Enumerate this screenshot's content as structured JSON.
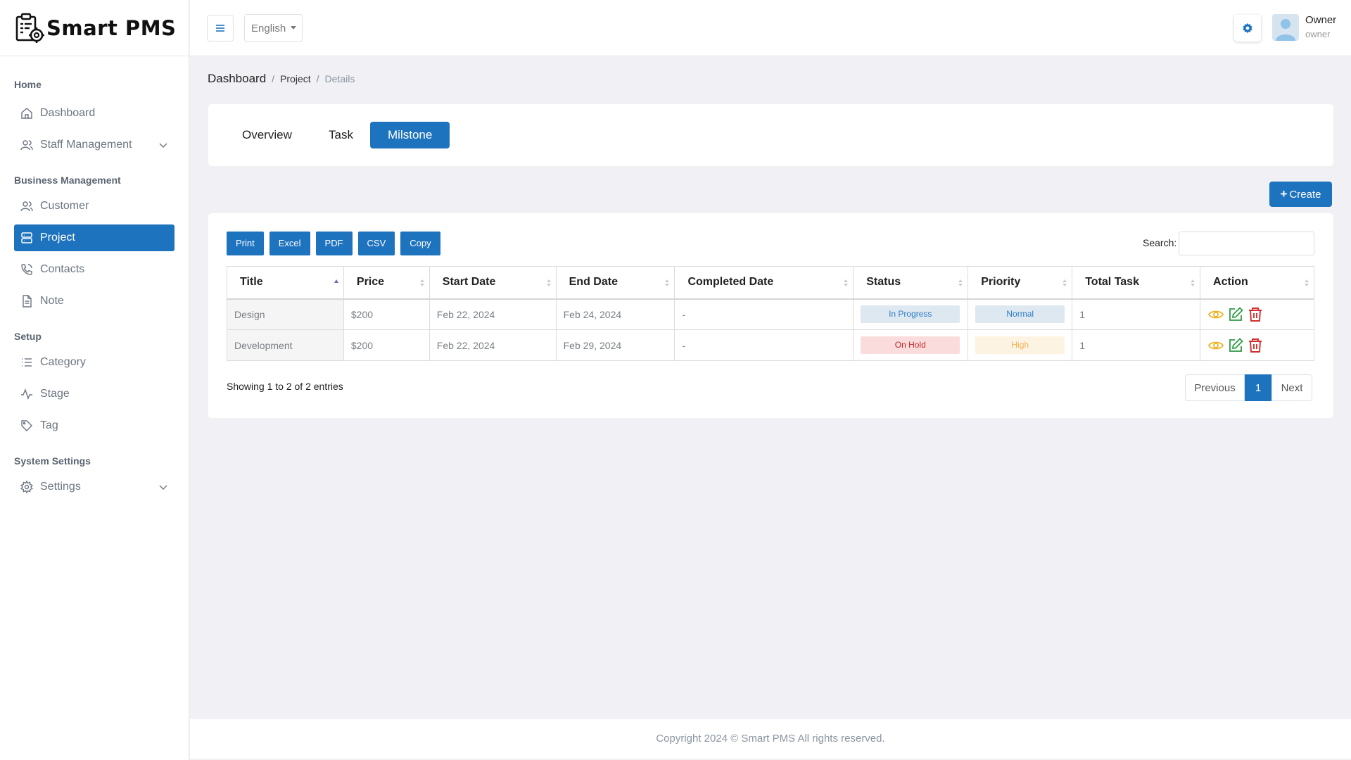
{
  "brand": {
    "name": "Smart PMS",
    "logo_icon": "clipboard-gear-icon"
  },
  "sidebar": {
    "sections": [
      {
        "label": "Home"
      },
      {
        "label": "Business Management"
      },
      {
        "label": "Setup"
      },
      {
        "label": "System Settings"
      }
    ],
    "items": {
      "dashboard": "Dashboard",
      "staff": "Staff Management",
      "customer": "Customer",
      "project": "Project",
      "contacts": "Contacts",
      "note": "Note",
      "category": "Category",
      "stage": "Stage",
      "tag": "Tag",
      "settings": "Settings"
    },
    "active_item": "Project"
  },
  "topbar": {
    "language": "English",
    "user": {
      "name": "Owner",
      "role": "owner"
    }
  },
  "breadcrumb": {
    "home": "Dashboard",
    "parent": "Project",
    "current": "Details",
    "separator": "/"
  },
  "tabs": [
    {
      "label": "Overview",
      "active": false
    },
    {
      "label": "Task",
      "active": false
    },
    {
      "label": "Milstone",
      "active": true
    }
  ],
  "create_button": {
    "label": "Create"
  },
  "export_buttons": [
    "Print",
    "Excel",
    "PDF",
    "CSV",
    "Copy"
  ],
  "search": {
    "label": "Search:",
    "value": ""
  },
  "table": {
    "columns": [
      "Title",
      "Price",
      "Start Date",
      "End Date",
      "Completed Date",
      "Status",
      "Priority",
      "Total Task",
      "Action"
    ],
    "sorted_column": "Title",
    "rows": [
      {
        "title": "Design",
        "price": "$200",
        "start": "Feb 22, 2024",
        "end": "Feb 24, 2024",
        "completed": "-",
        "status": "In Progress",
        "priority": "Normal",
        "total": "1"
      },
      {
        "title": "Development",
        "price": "$200",
        "start": "Feb 22, 2024",
        "end": "Feb 29, 2024",
        "completed": "-",
        "status": "On Hold",
        "priority": "High",
        "total": "1"
      }
    ]
  },
  "pagination": {
    "info": "Showing 1 to 2 of 2 entries",
    "previous": "Previous",
    "current_page": "1",
    "next": "Next"
  },
  "footer": {
    "text": "Copyright 2024 © Smart PMS All rights reserved."
  },
  "colors": {
    "primary": "#1e73be",
    "status_in_progress_bg": "#dde8f1",
    "status_in_progress_fg": "#2d7bc4",
    "status_on_hold_bg": "#fadcdc",
    "status_on_hold_fg": "#c62828",
    "priority_normal_bg": "#dde8f1",
    "priority_normal_fg": "#2d7bc4",
    "priority_high_bg": "#fdf3e2",
    "priority_high_fg": "#f0b35a",
    "view_icon": "#f0b429",
    "edit_icon": "#2e9b45",
    "delete_icon": "#d32f2f"
  }
}
